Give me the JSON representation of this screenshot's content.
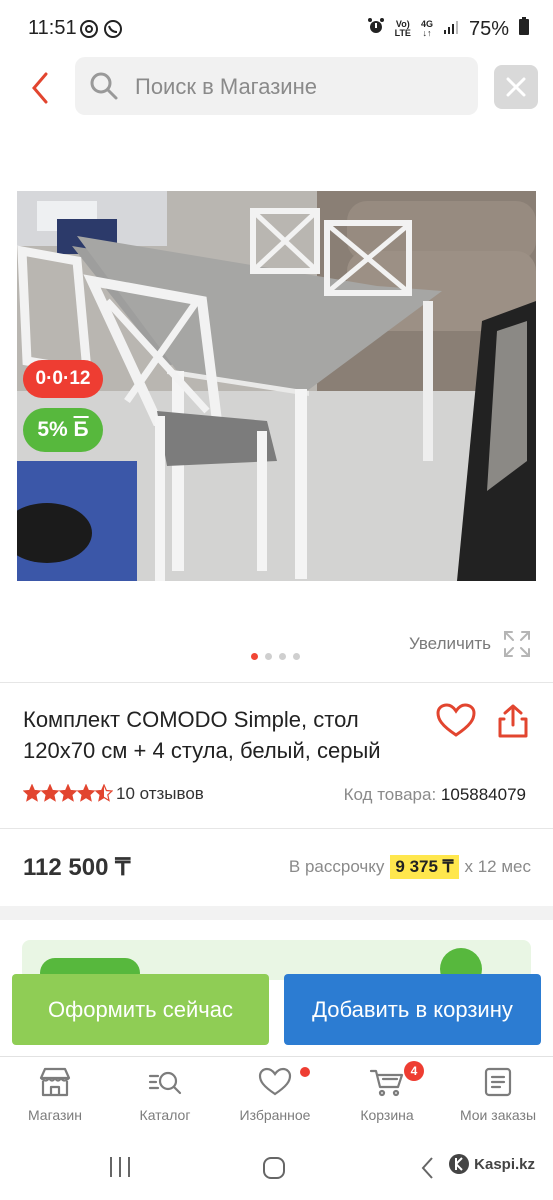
{
  "status_bar": {
    "time": "11:51",
    "network_top": "Vo)",
    "network_bottom": "LTE",
    "net_4g": "4G",
    "battery": "75%"
  },
  "header": {
    "search_placeholder": "Поиск в Магазине"
  },
  "product": {
    "badge_installment": "0·0·12",
    "badge_bonus_value": "5%",
    "badge_bonus_letter": "Б",
    "zoom_label": "Увеличить",
    "image_count": 4,
    "active_image": 1,
    "title": "Комплект COMODO Simple, стол 120x70 см + 4 стула, белый, серый",
    "rating": 4.5,
    "reviews": "10 отзывов",
    "code_label": "Код товара:",
    "code_value": "105884079",
    "price": "112 500 ₸",
    "installment_label": "В рассрочку",
    "installment_value": "9 375 ₸",
    "installment_term": "x 12 мес"
  },
  "actions": {
    "buy_now": "Оформить сейчас",
    "add_to_cart": "Добавить в корзину"
  },
  "tabs": [
    {
      "label": "Магазин"
    },
    {
      "label": "Каталог"
    },
    {
      "label": "Избранное"
    },
    {
      "label": "Корзина",
      "badge": "4"
    },
    {
      "label": "Мои заказы"
    }
  ],
  "watermark": "Kaspi.kz",
  "colors": {
    "brand_red": "#ee3d32",
    "green": "#8fcd55",
    "blue": "#2c7cd2",
    "bonus_green": "#57b83d",
    "highlight": "#ffe74d"
  }
}
